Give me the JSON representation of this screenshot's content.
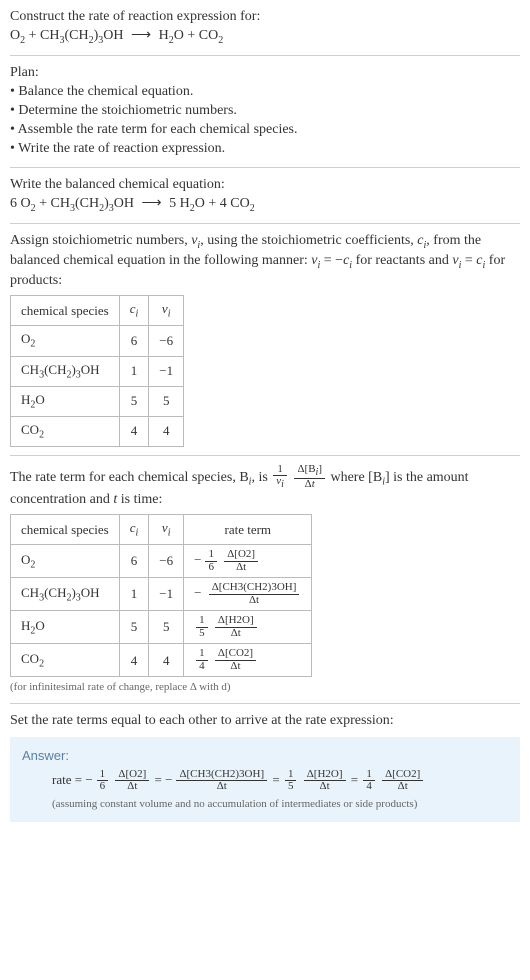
{
  "prompt": {
    "line1": "Construct the rate of reaction expression for:",
    "eq_lhs_O2": "O",
    "eq_plus1": " + ",
    "eq_but": "CH",
    "eq_but2": "(CH",
    "eq_but3": ")",
    "eq_but4": "OH",
    "eq_arrow": "⟶",
    "eq_rhs_H2O": "H",
    "eq_rhs_O": "O",
    "eq_plus2": " + ",
    "eq_rhs_CO2": "CO"
  },
  "subs": {
    "two": "2",
    "three": "3",
    "i": "i"
  },
  "plan": {
    "title": "Plan:",
    "b1": "• Balance the chemical equation.",
    "b2": "• Determine the stoichiometric numbers.",
    "b3": "• Assemble the rate term for each chemical species.",
    "b4": "• Write the rate of reaction expression."
  },
  "balanced": {
    "title": "Write the balanced chemical equation:",
    "c1": "6 ",
    "c2": "5 ",
    "c3": "4 "
  },
  "stoich": {
    "intro_a": "Assign stoichiometric numbers, ",
    "intro_b": ", using the stoichiometric coefficients, ",
    "intro_c": ", from the balanced chemical equation in the following manner: ",
    "intro_d": " for reactants and ",
    "intro_e": " for products:",
    "nu": "ν",
    "c": "c",
    "eq1": " = −",
    "eq2": " = ",
    "header_species": "chemical species",
    "header_c": "c",
    "header_nu": "ν",
    "r1": {
      "sp": "O",
      "c": "6",
      "nu": "−6"
    },
    "r2": {
      "sp": "CH3(CH2)3OH",
      "c": "1",
      "nu": "−1"
    },
    "r3": {
      "sp": "H",
      "c": "5",
      "nu": "5"
    },
    "r4": {
      "sp": "CO",
      "c": "4",
      "nu": "4"
    }
  },
  "rate_intro": {
    "a": "The rate term for each chemical species, B",
    "b": ", is ",
    "frac1_num": "1",
    "frac1_den_nu": "ν",
    "frac2_num": "Δ[B",
    "frac2_num_end": "]",
    "frac2_den": "Δt",
    "c": " where [B",
    "d": "] is the amount concentration and ",
    "t": "t",
    "e": " is time:"
  },
  "rate_table": {
    "header_rate": "rate term",
    "r1": {
      "coef": "6",
      "sign": "−",
      "numc": "1",
      "denc": "6",
      "conc": "Δ[O2]",
      "den": "Δt"
    },
    "r2": {
      "coef": "1",
      "sign": "−",
      "conc": "Δ[CH3(CH2)3OH]",
      "den": "Δt"
    },
    "r3": {
      "coef": "5",
      "numc": "1",
      "denc": "5",
      "conc": "Δ[H2O]",
      "den": "Δt"
    },
    "r4": {
      "coef": "4",
      "numc": "1",
      "denc": "4",
      "conc": "Δ[CO2]",
      "den": "Δt"
    }
  },
  "footnote": "(for infinitesimal rate of change, replace Δ with d)",
  "final_line": "Set the rate terms equal to each other to arrive at the rate expression:",
  "answer": {
    "label": "Answer:",
    "lead": "rate = ",
    "eq": " = ",
    "assume": "(assuming constant volume and no accumulation of intermediates or side products)"
  },
  "chart_data": {
    "type": "table",
    "tables": [
      {
        "title": "stoichiometric numbers",
        "columns": [
          "chemical species",
          "c_i",
          "ν_i"
        ],
        "rows": [
          [
            "O2",
            6,
            -6
          ],
          [
            "CH3(CH2)3OH",
            1,
            -1
          ],
          [
            "H2O",
            5,
            5
          ],
          [
            "CO2",
            4,
            4
          ]
        ]
      },
      {
        "title": "rate terms",
        "columns": [
          "chemical species",
          "c_i",
          "ν_i",
          "rate term"
        ],
        "rows": [
          [
            "O2",
            6,
            -6,
            "-(1/6) Δ[O2]/Δt"
          ],
          [
            "CH3(CH2)3OH",
            1,
            -1,
            "- Δ[CH3(CH2)3OH]/Δt"
          ],
          [
            "H2O",
            5,
            5,
            "(1/5) Δ[H2O]/Δt"
          ],
          [
            "CO2",
            4,
            4,
            "(1/4) Δ[CO2]/Δt"
          ]
        ]
      }
    ],
    "rate_expression": "rate = -(1/6) Δ[O2]/Δt = - Δ[CH3(CH2)3OH]/Δt = (1/5) Δ[H2O]/Δt = (1/4) Δ[CO2]/Δt"
  }
}
